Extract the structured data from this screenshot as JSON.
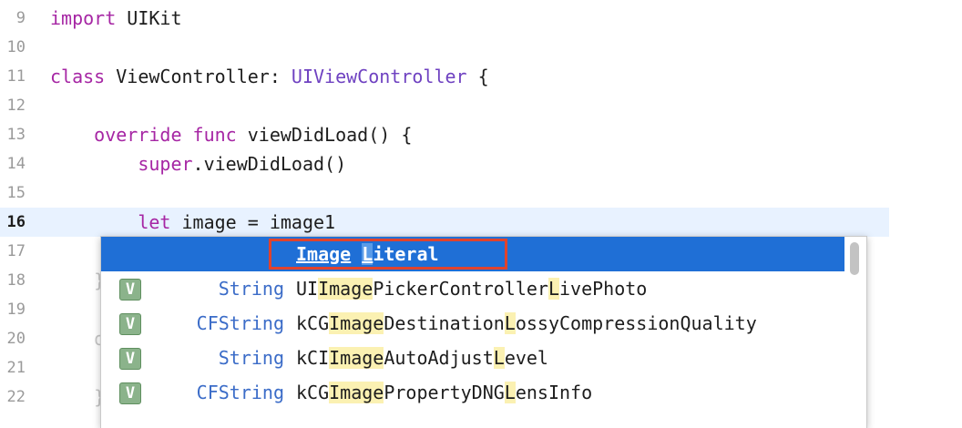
{
  "editor": {
    "lines": [
      {
        "num": "9",
        "segments": [
          {
            "t": "import",
            "c": "kw"
          },
          {
            "t": " UIKit",
            "c": "fn"
          }
        ]
      },
      {
        "num": "10",
        "segments": []
      },
      {
        "num": "11",
        "segments": [
          {
            "t": "class",
            "c": "kw"
          },
          {
            "t": " ViewController: ",
            "c": "fn"
          },
          {
            "t": "UIViewController",
            "c": "ty"
          },
          {
            "t": " {",
            "c": "fn"
          }
        ]
      },
      {
        "num": "12",
        "segments": []
      },
      {
        "num": "13",
        "segments": [
          {
            "t": "    override func",
            "c": "kw"
          },
          {
            "t": " viewDidLoad() {",
            "c": "fn"
          }
        ]
      },
      {
        "num": "14",
        "segments": [
          {
            "t": "        super",
            "c": "kw"
          },
          {
            "t": ".viewDidLoad()",
            "c": "fn"
          }
        ]
      },
      {
        "num": "15",
        "segments": []
      },
      {
        "num": "16",
        "segments": [
          {
            "t": "        let",
            "c": "kw"
          },
          {
            "t": " image = image1",
            "c": "fn"
          }
        ],
        "current": true
      },
      {
        "num": "17",
        "segments": []
      },
      {
        "num": "18",
        "segments": [
          {
            "t": "    }",
            "c": "ghost"
          }
        ]
      },
      {
        "num": "19",
        "segments": []
      },
      {
        "num": "20",
        "segments": [
          {
            "t": "    override func didReceiveMemoryWarning() {",
            "c": "ghost"
          }
        ]
      },
      {
        "num": "21",
        "segments": [
          {
            "t": "        super.didReceiveMemoryWarning()",
            "c": "ghost"
          }
        ]
      },
      {
        "num": "22",
        "segments": [
          {
            "t": "    }",
            "c": "ghost"
          }
        ]
      }
    ]
  },
  "completion": {
    "selected": {
      "word1": "Image",
      "word2_first": "L",
      "word2_rest": "iteral"
    },
    "items": [
      {
        "badge": "V",
        "type": "String",
        "name_parts": [
          {
            "t": "UI"
          },
          {
            "t": "Image",
            "m": true
          },
          {
            "t": "PickerController"
          },
          {
            "t": "L",
            "m": true
          },
          {
            "t": "ivePhoto"
          }
        ]
      },
      {
        "badge": "V",
        "type": "CFString",
        "name_parts": [
          {
            "t": "kCG"
          },
          {
            "t": "Image",
            "m": true
          },
          {
            "t": "Destination"
          },
          {
            "t": "L",
            "m": true
          },
          {
            "t": "ossyCompressionQuality"
          }
        ]
      },
      {
        "badge": "V",
        "type": "String",
        "name_parts": [
          {
            "t": "kCI"
          },
          {
            "t": "Image",
            "m": true
          },
          {
            "t": "AutoAdjust"
          },
          {
            "t": "L",
            "m": true
          },
          {
            "t": "evel"
          }
        ]
      },
      {
        "badge": "V",
        "type": "CFString",
        "name_parts": [
          {
            "t": "kCG"
          },
          {
            "t": "Image",
            "m": true
          },
          {
            "t": "PropertyDNG"
          },
          {
            "t": "L",
            "m": true
          },
          {
            "t": "ensInfo"
          }
        ]
      }
    ]
  }
}
